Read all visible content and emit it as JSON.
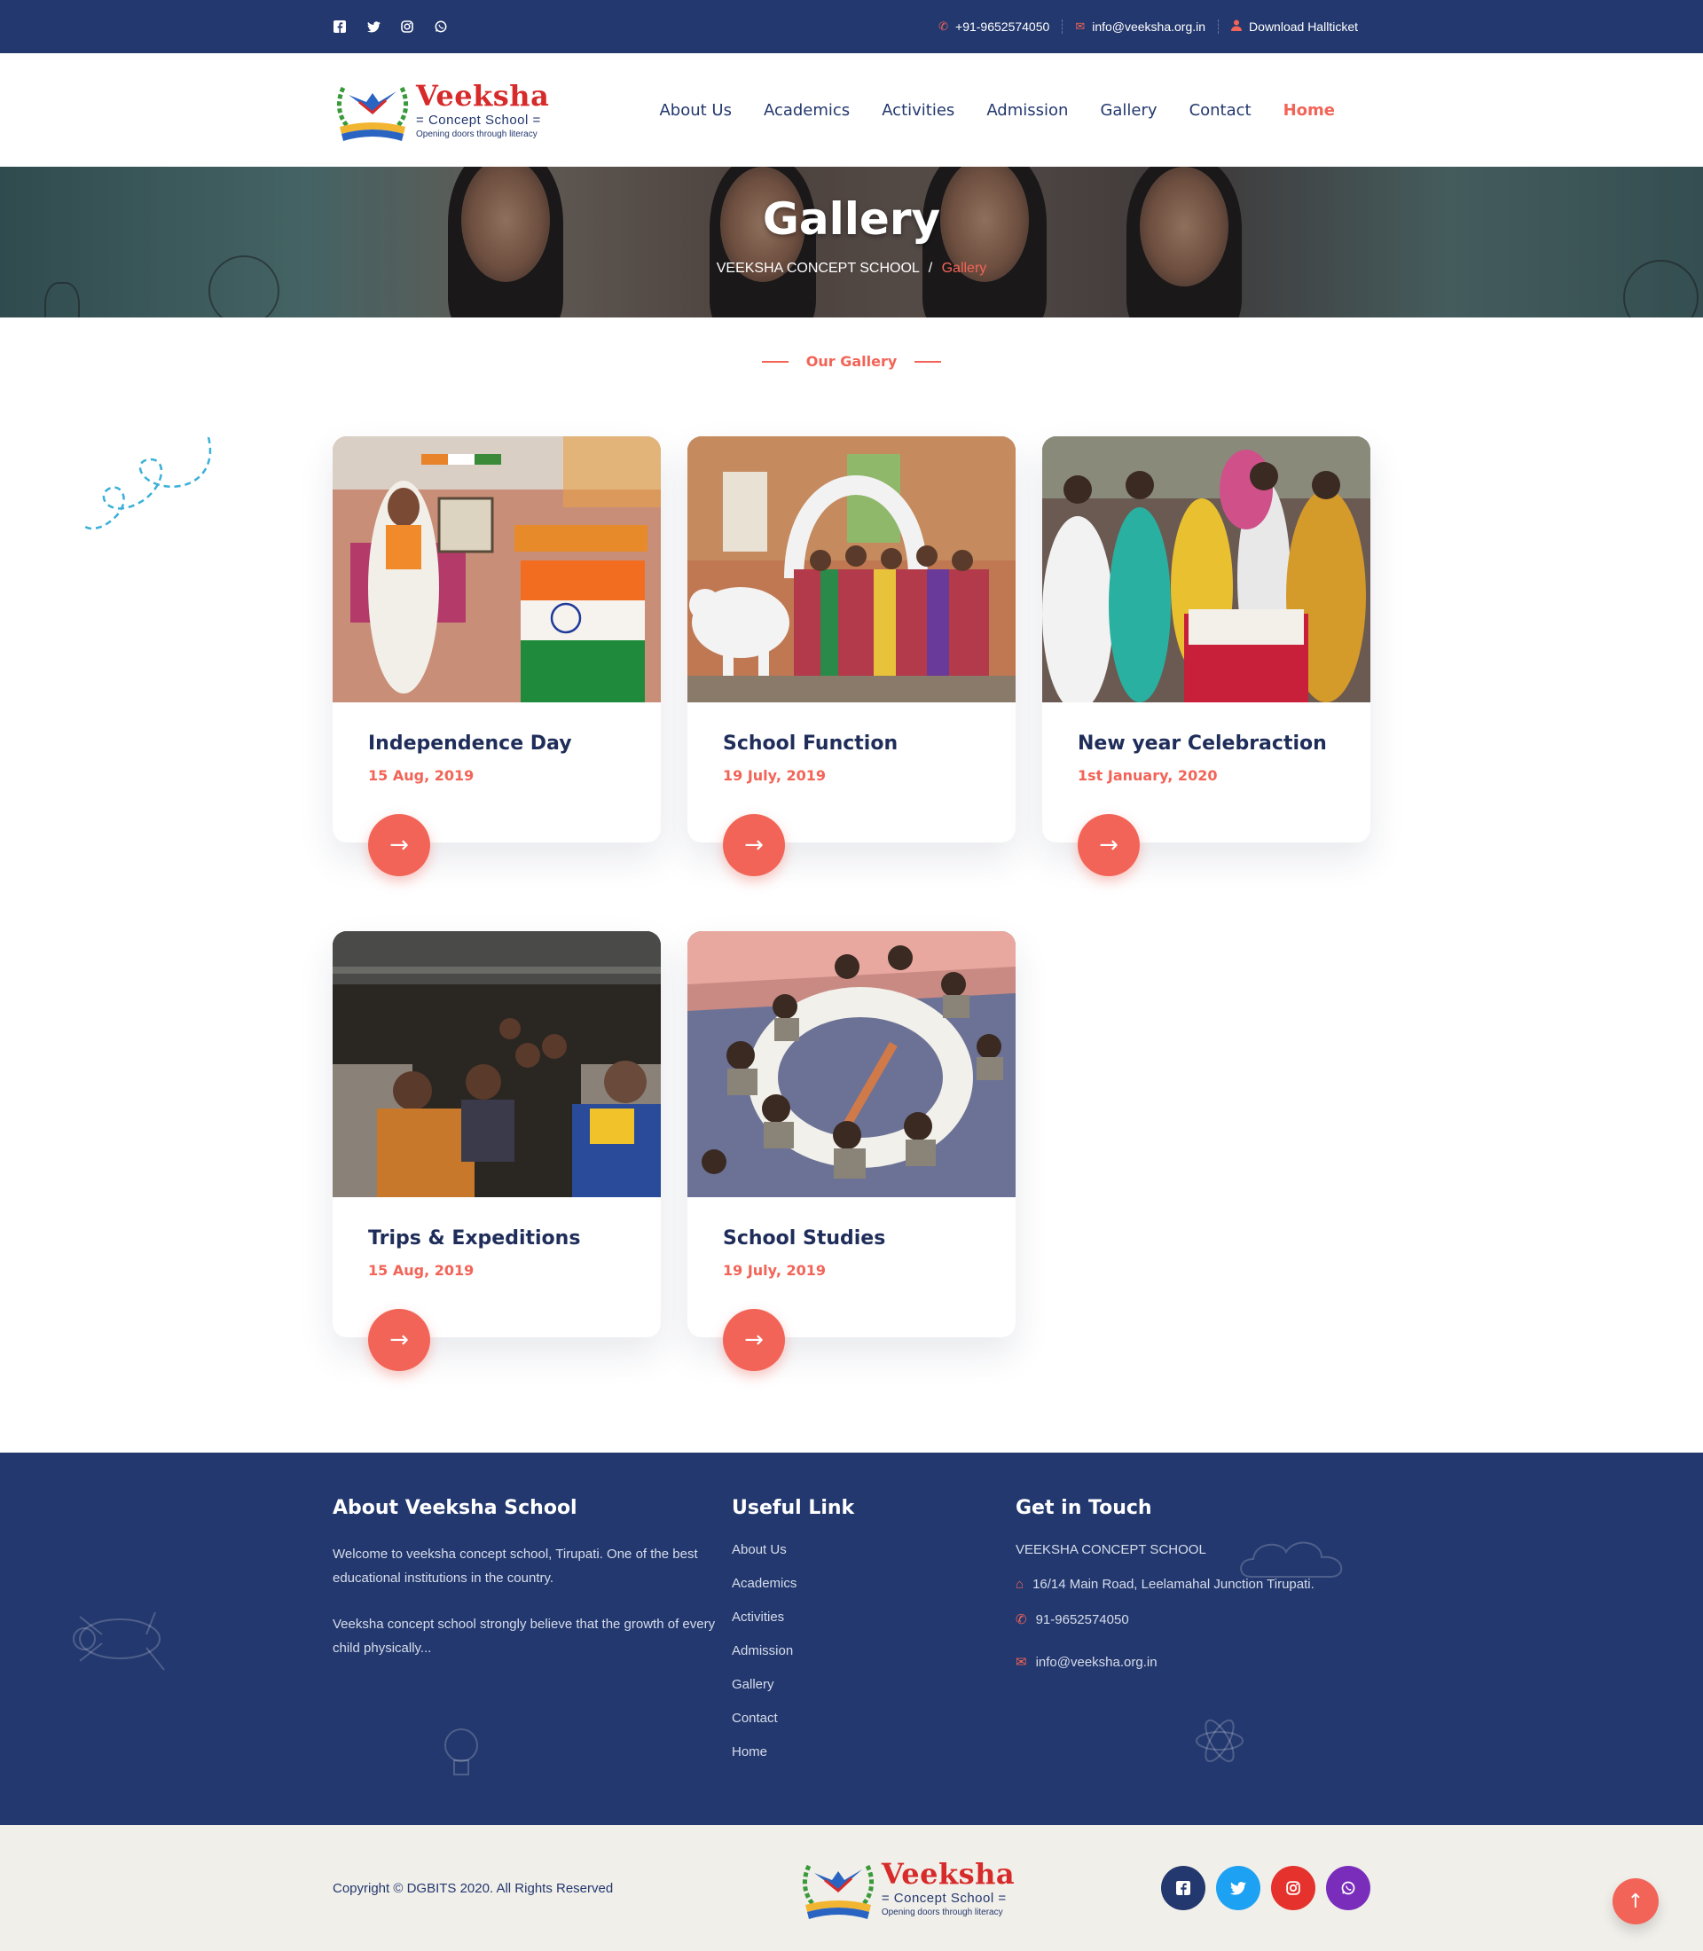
{
  "topbar": {
    "social": [
      {
        "name": "facebook-icon",
        "glyph": "f"
      },
      {
        "name": "twitter-icon",
        "glyph": "t"
      },
      {
        "name": "instagram-icon",
        "glyph": "◎"
      },
      {
        "name": "whatsapp-icon",
        "glyph": "✆"
      }
    ],
    "phone": "+91-9652574050",
    "email": "info@veeksha.org.in",
    "hallticket": "Download Hallticket"
  },
  "logo": {
    "name": "Veeksha",
    "sub": "Concept School",
    "tagline": "Opening doors through literacy"
  },
  "nav": [
    "About Us",
    "Academics",
    "Activities",
    "Admission",
    "Gallery",
    "Contact",
    "Home"
  ],
  "nav_active": "Home",
  "banner": {
    "title": "Gallery",
    "crumb_root": "VEEKSHA CONCEPT SCHOOL",
    "crumb_sep": "/",
    "crumb_current": "Gallery"
  },
  "gallery": {
    "label": "Our Gallery",
    "items": [
      {
        "title": "Independence Day",
        "date": "15 Aug, 2019"
      },
      {
        "title": "School Function",
        "date": "19 July, 2019"
      },
      {
        "title": "New year Celebraction",
        "date": "1st January, 2020"
      },
      {
        "title": "Trips & Expeditions",
        "date": "15 Aug, 2019"
      },
      {
        "title": "School Studies",
        "date": "19 July, 2019"
      }
    ]
  },
  "footer": {
    "about_title": "About Veeksha School",
    "about_p1": "Welcome to veeksha concept school, Tirupati. One of the best educational institutions in the country.",
    "about_p2": "Veeksha concept school strongly believe that the growth of every child physically...",
    "links_title": "Useful Link",
    "links": [
      "About Us",
      "Academics",
      "Activities",
      "Admission",
      "Gallery",
      "Contact",
      "Home"
    ],
    "touch_title": "Get in Touch",
    "touch_name": "VEEKSHA CONCEPT SCHOOL",
    "touch_address": "16/14 Main Road, Leelamahal Junction Tirupati.",
    "touch_phone": "91-9652574050",
    "touch_email": "info@veeksha.org.in"
  },
  "bottom": {
    "copyright": "Copyright © DGBITS 2020. All Rights Reserved",
    "social_colors": {
      "facebook": "#23386e",
      "twitter": "#1da1f2",
      "instagram": "#e5322d",
      "whatsapp": "#7a2dbb"
    }
  },
  "colors": {
    "primary": "#23386e",
    "accent": "#f26457"
  }
}
